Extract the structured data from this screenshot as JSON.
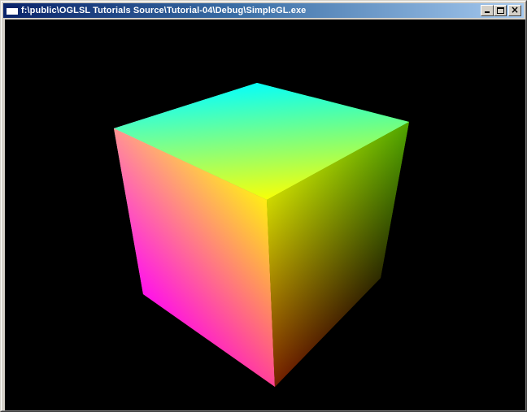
{
  "window": {
    "title": "f:\\public\\OGLSL Tutorials Source\\Tutorial-04\\Debug\\SimpleGL.exe",
    "controls": {
      "minimize": "minimize-icon",
      "maximize": "maximize-icon",
      "close": "close-icon"
    }
  },
  "viewport": {
    "background": "#000000",
    "scene": "rgb-color-cube",
    "vertex_colors": {
      "top_back": "#00ffff",
      "top_left": "#ffffff",
      "top_right": "#00ff00",
      "top_center": "#ffff00",
      "left_bottom": "#ff00ff",
      "bottom_front": "#ff0000",
      "right_bottom": "#000000"
    }
  }
}
